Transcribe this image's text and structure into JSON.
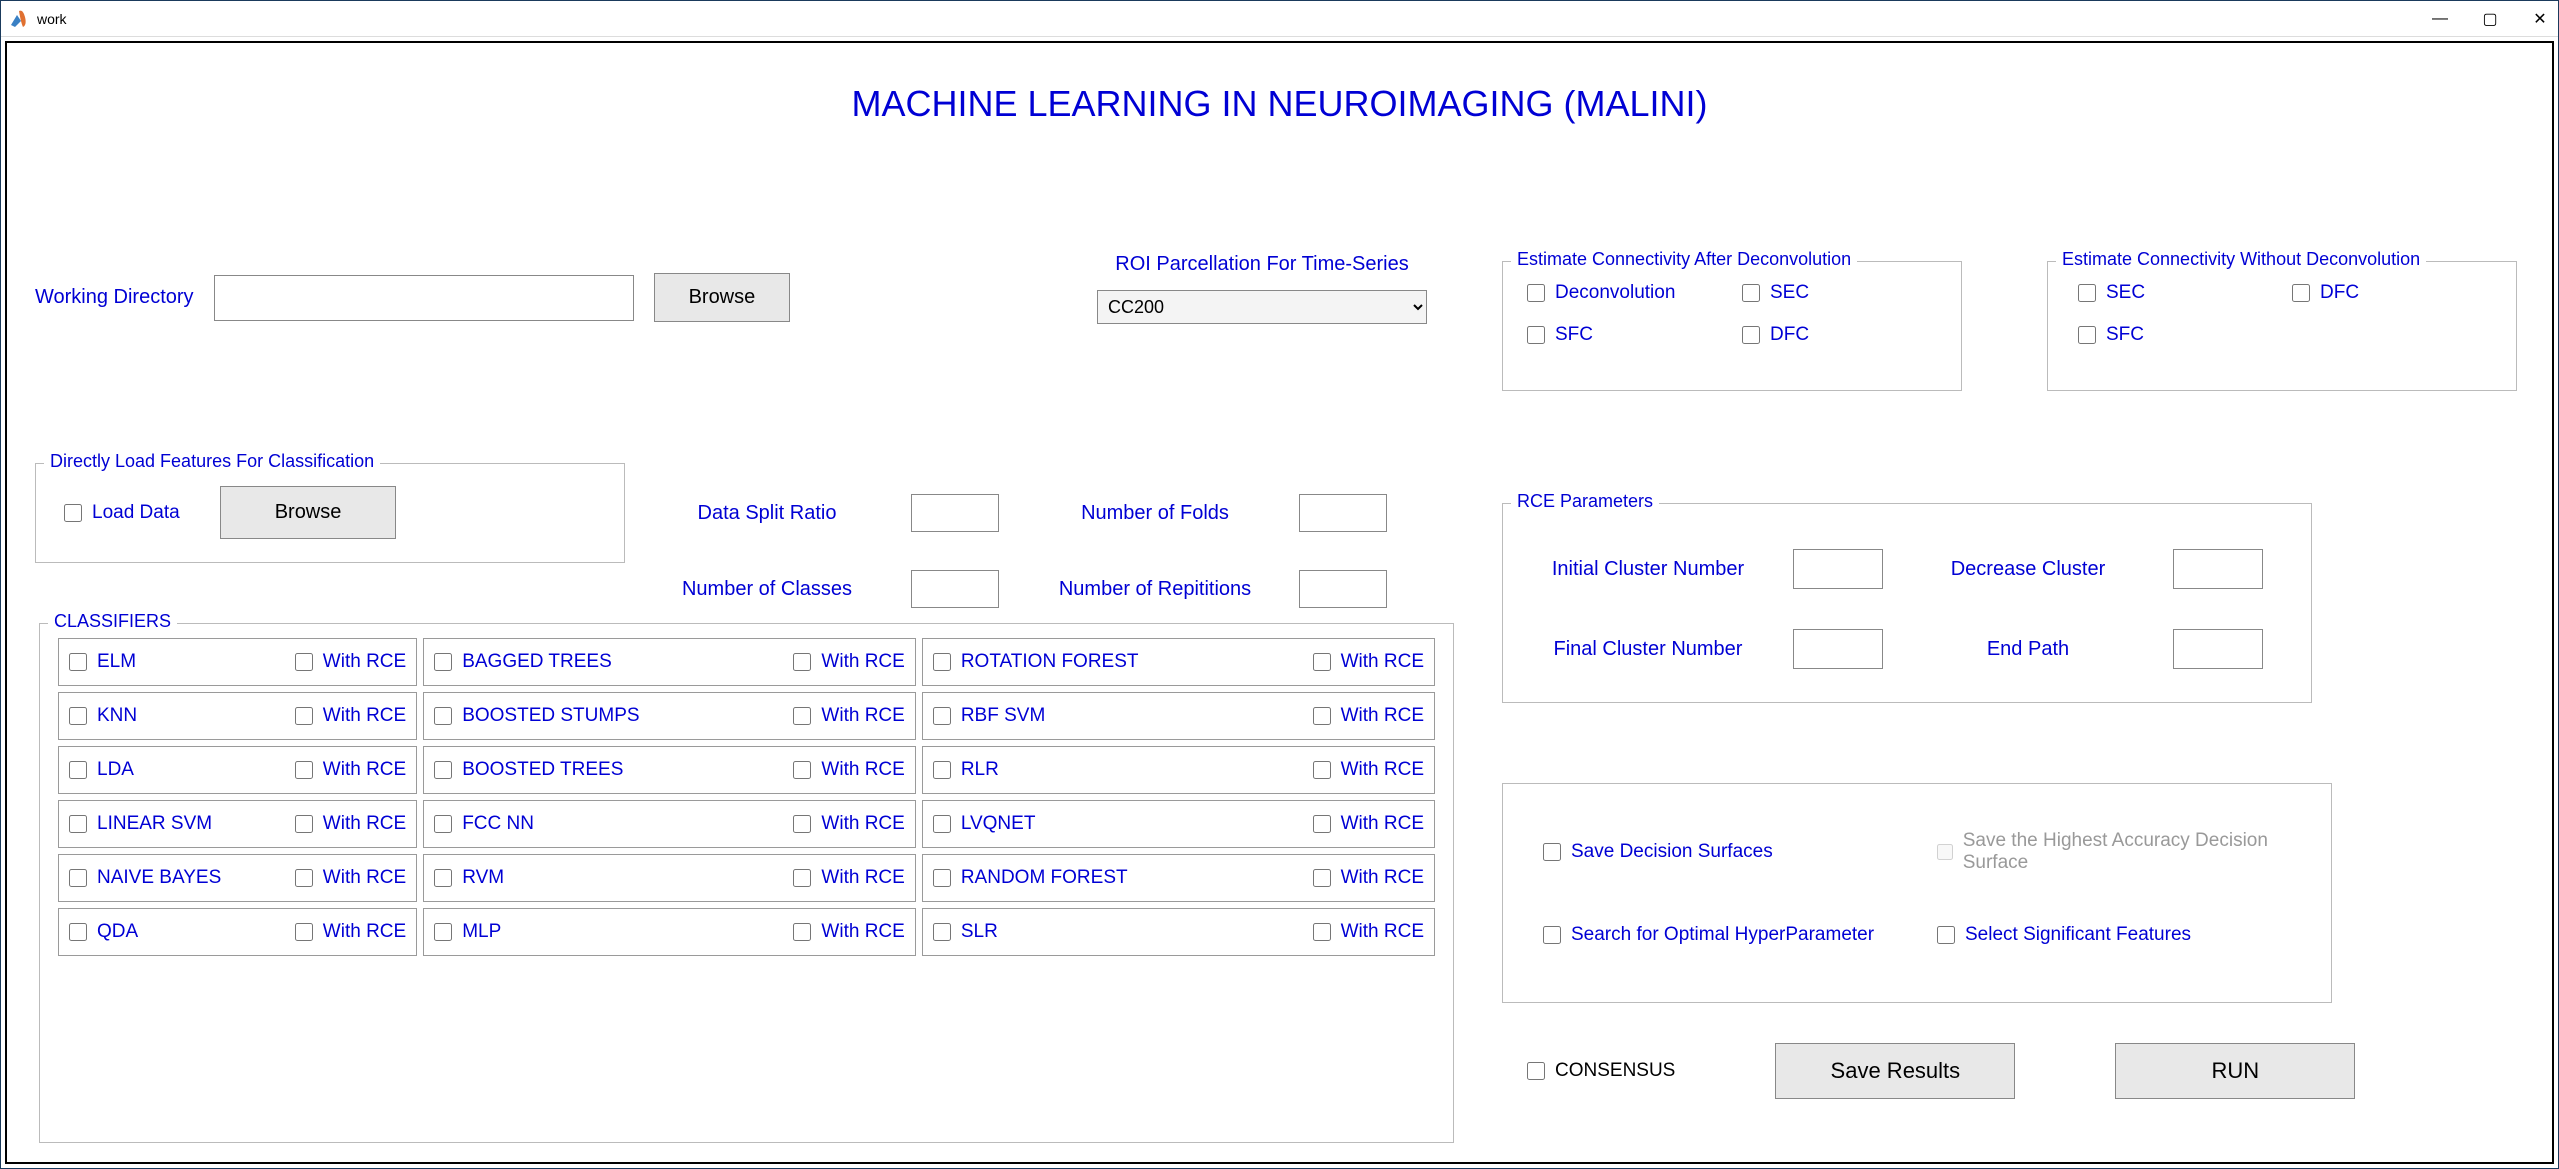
{
  "window": {
    "title": "work"
  },
  "main_title": "MACHINE LEARNING IN NEUROIMAGING (MALINI)",
  "working_directory": {
    "label": "Working Directory",
    "value": "",
    "browse": "Browse"
  },
  "roi": {
    "label": "ROI Parcellation For Time-Series",
    "selected": "CC200"
  },
  "conn_after": {
    "legend": "Estimate Connectivity After Deconvolution",
    "deconv": "Deconvolution",
    "sec": "SEC",
    "sfc": "SFC",
    "dfc": "DFC"
  },
  "conn_without": {
    "legend": "Estimate Connectivity Without Deconvolution",
    "sec": "SEC",
    "dfc": "DFC",
    "sfc": "SFC"
  },
  "load": {
    "legend": "Directly Load Features For Classification",
    "load_data": "Load Data",
    "browse": "Browse"
  },
  "split": {
    "ratio": "Data Split Ratio",
    "folds": "Number of Folds",
    "classes": "Number of Classes",
    "reps": "Number of Repititions",
    "ratio_v": "",
    "folds_v": "",
    "classes_v": "",
    "reps_v": ""
  },
  "rce": {
    "legend": "RCE Parameters",
    "initial": "Initial Cluster Number",
    "decrease": "Decrease Cluster",
    "final": "Final Cluster Number",
    "endpath": "End Path",
    "initial_v": "",
    "decrease_v": "",
    "final_v": "",
    "endpath_v": ""
  },
  "classifiers": {
    "legend": "CLASSIFIERS",
    "with_rce": "With RCE",
    "col1": [
      "ELM",
      "KNN",
      "LDA",
      "LINEAR SVM",
      "NAIVE BAYES",
      "QDA"
    ],
    "col2": [
      "BAGGED TREES",
      "BOOSTED STUMPS",
      "BOOSTED TREES",
      "FCC NN",
      "RVM",
      "MLP"
    ],
    "col3": [
      "ROTATION FOREST",
      "RBF SVM",
      "RLR",
      "LVQNET",
      "RANDOM FOREST",
      "SLR"
    ]
  },
  "options": {
    "save_surf": "Save Decision Surfaces",
    "save_highest": "Save the Highest Accuracy Decision Surface",
    "search_hp": "Search for Optimal HyperParameter",
    "sel_sig": "Select Significant Features"
  },
  "bottom": {
    "consensus": "CONSENSUS",
    "save_results": "Save Results",
    "run": "RUN"
  }
}
